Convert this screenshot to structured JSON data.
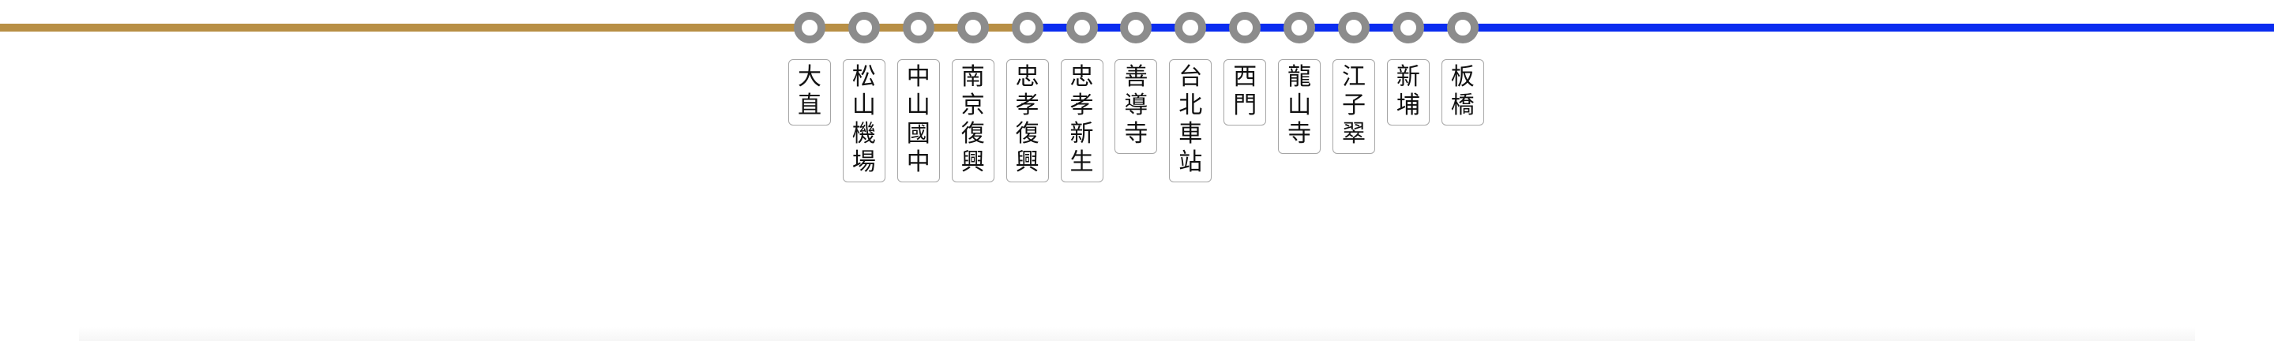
{
  "lines": {
    "gold_color": "#b88f45",
    "blue_color": "#0a2cf0"
  },
  "stations": [
    {
      "name": "大直"
    },
    {
      "name": "松山機場"
    },
    {
      "name": "中山國中"
    },
    {
      "name": "南京復興"
    },
    {
      "name": "忠孝復興"
    },
    {
      "name": "忠孝新生"
    },
    {
      "name": "善導寺"
    },
    {
      "name": "台北車站"
    },
    {
      "name": "西門"
    },
    {
      "name": "龍山寺"
    },
    {
      "name": "江子翠"
    },
    {
      "name": "新埔"
    },
    {
      "name": "板橋"
    }
  ]
}
